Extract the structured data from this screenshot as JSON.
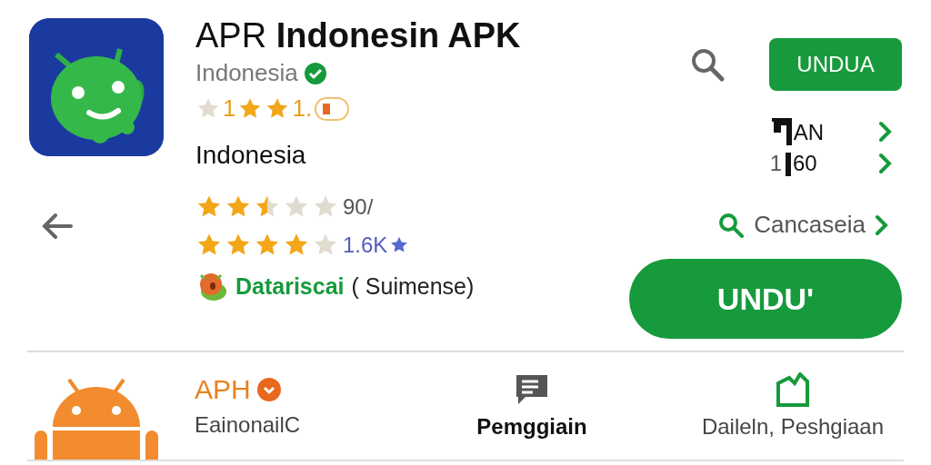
{
  "app": {
    "title_light": "APR",
    "title_bold": "Indonesin APK",
    "publisher": "Indonesia",
    "verified": true,
    "badge_row": [
      {
        "kind": "star",
        "faded": true
      },
      {
        "kind": "text",
        "text": "1"
      },
      {
        "kind": "star",
        "faded": false
      },
      {
        "kind": "star",
        "faded": false
      },
      {
        "kind": "text",
        "text": "1."
      }
    ],
    "region": "Indonesia",
    "ratings": [
      {
        "stars": 2.5,
        "reading": "90/",
        "accent": false
      },
      {
        "stars": 4,
        "reading": "1.6K",
        "accent": true
      }
    ],
    "developer": {
      "name": "Datariscai",
      "note": "( Suimense)"
    }
  },
  "actions": {
    "small_button": "UNDUA",
    "stats": [
      {
        "text": "AN"
      },
      {
        "prefix": "1",
        "text": "60"
      }
    ],
    "link": "Cancaseia",
    "big_button": "UNDU'"
  },
  "bottom": [
    {
      "kind": "developer",
      "title": "APH",
      "subtitle": "EainonailC"
    },
    {
      "kind": "reviews",
      "subtitle": "Pemggiain"
    },
    {
      "kind": "share",
      "subtitle": "Daileln, Peshgiaan"
    }
  ]
}
